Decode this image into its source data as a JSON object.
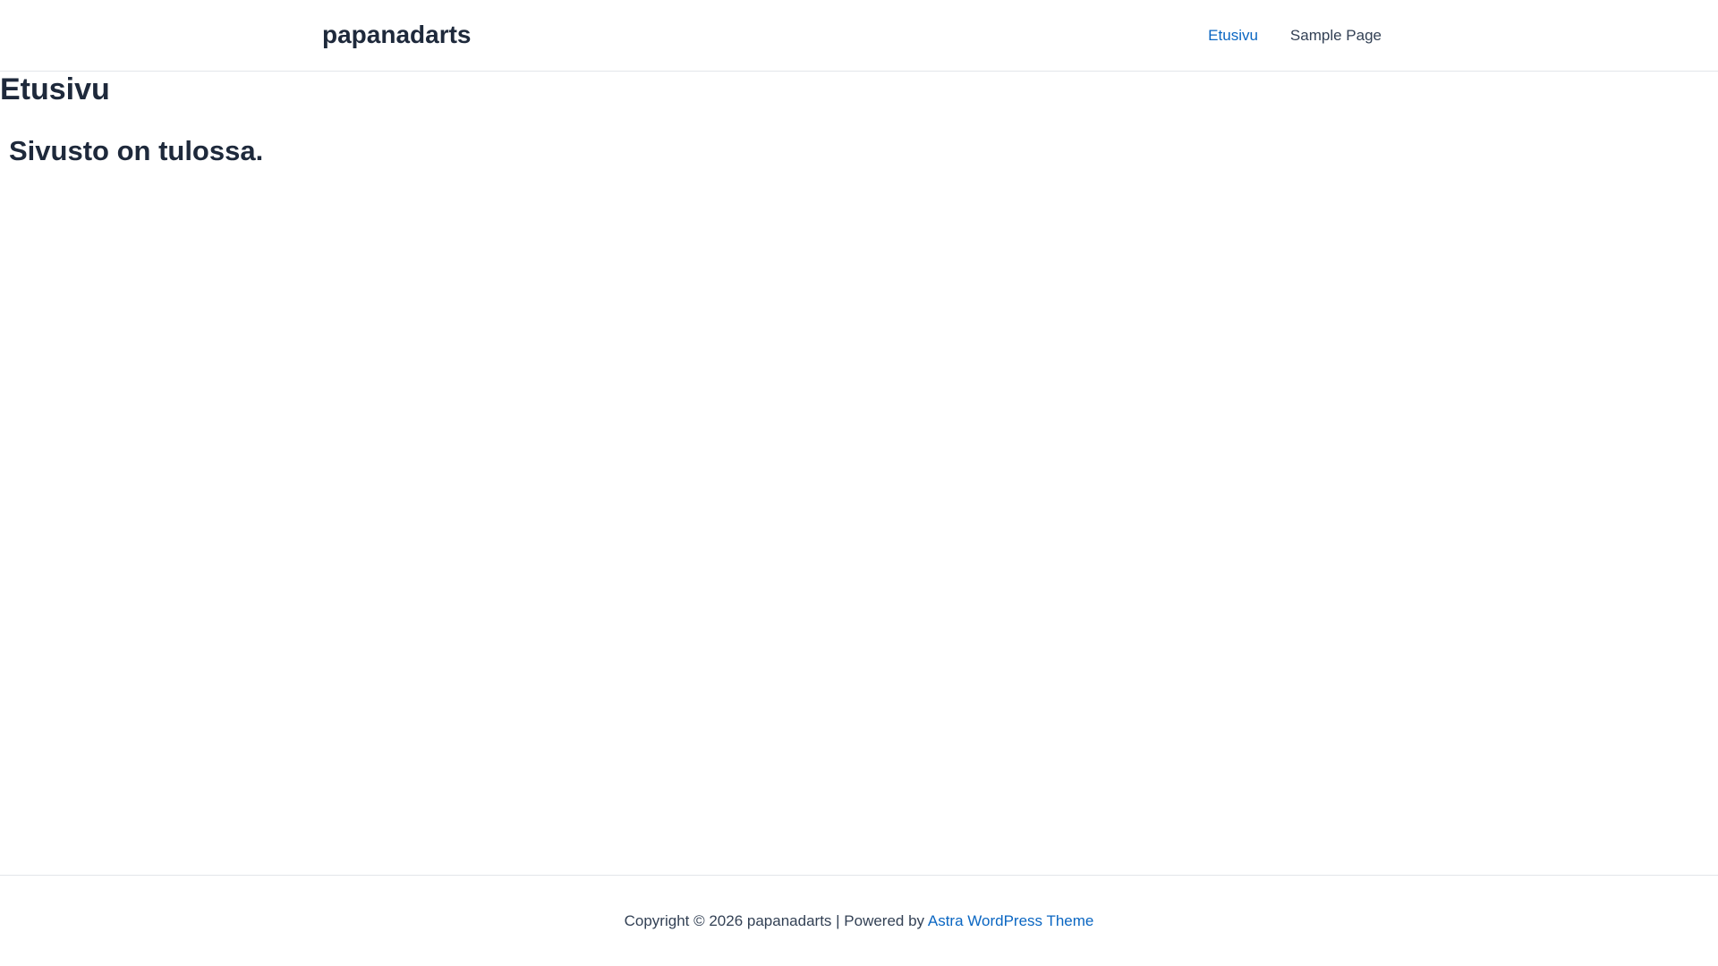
{
  "header": {
    "site_title": "papanadarts",
    "nav_items": [
      {
        "label": "Etusivu",
        "active": true
      },
      {
        "label": "Sample Page",
        "active": false
      }
    ]
  },
  "page": {
    "title": "Etusivu",
    "heading": "Sivusto on tulossa."
  },
  "footer": {
    "copyright_prefix": "Copyright © 2026 papanadarts | Powered by",
    "theme_link": "Astra WordPress Theme"
  },
  "colors": {
    "text": "#1e293b",
    "link_accent": "#0a66c2",
    "border": "#e3e6ea",
    "background": "#ffffff"
  }
}
